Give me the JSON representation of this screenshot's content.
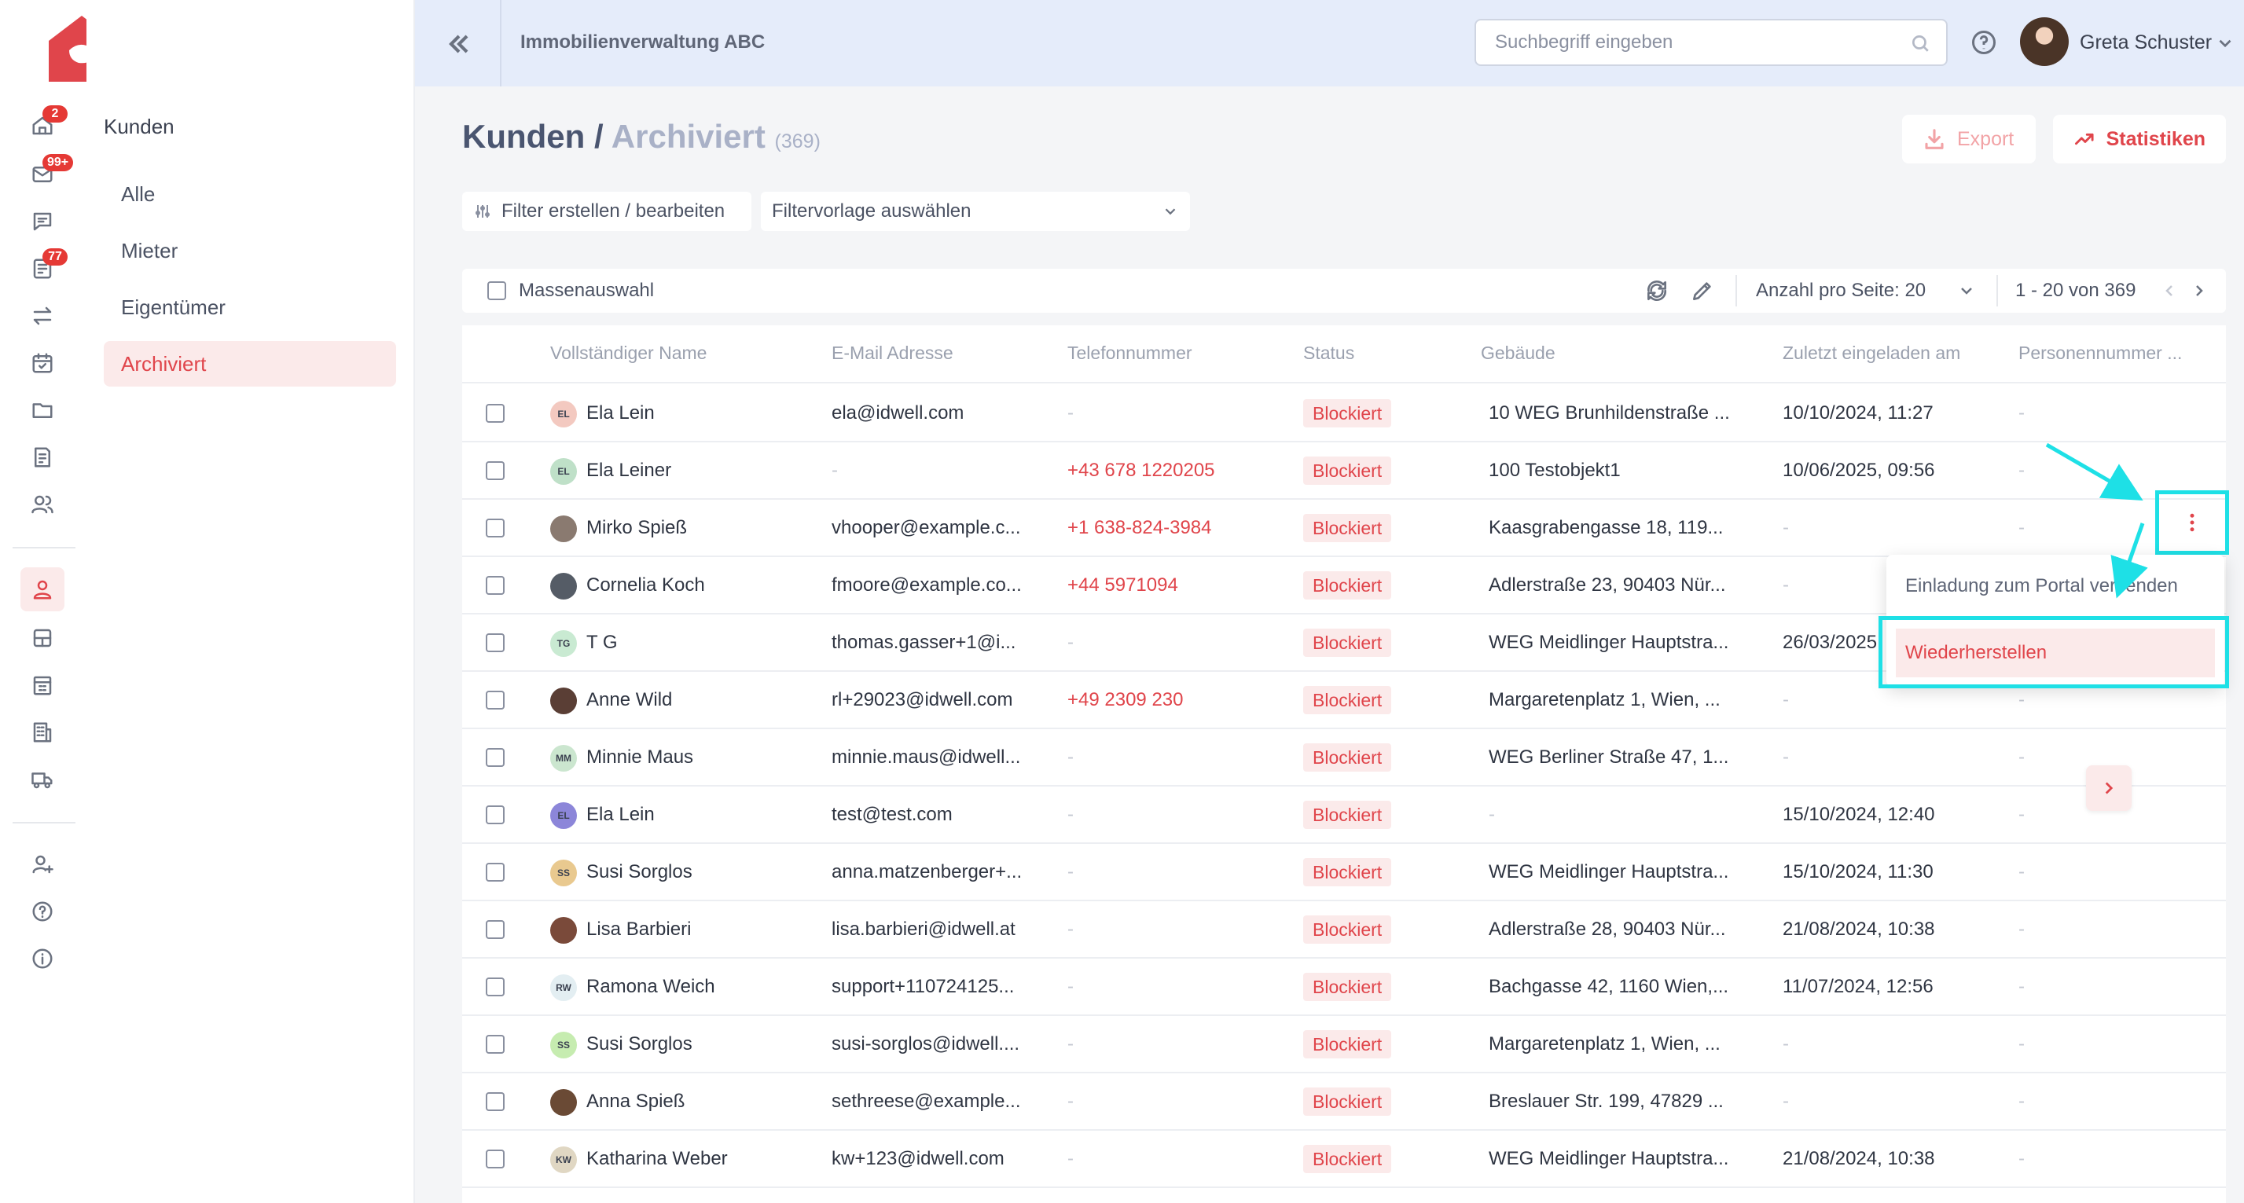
{
  "brand": {
    "name": "idwell"
  },
  "topbar": {
    "org_name": "Immobilienverwaltung ABC",
    "search_placeholder": "Suchbegriff eingeben",
    "user_name": "Greta Schuster"
  },
  "rail": {
    "badges": {
      "home": "2",
      "mail": "99+",
      "tasks": "77"
    }
  },
  "subnav": {
    "title": "Kunden",
    "items": [
      {
        "label": "Alle"
      },
      {
        "label": "Mieter"
      },
      {
        "label": "Eigentümer"
      },
      {
        "label": "Archiviert"
      }
    ]
  },
  "header": {
    "crumb_root": "Kunden",
    "crumb_sep": "/",
    "crumb_active": "Archiviert",
    "count": "(369)",
    "export_label": "Export",
    "stats_label": "Statistiken"
  },
  "filters": {
    "create_label": "Filter erstellen / bearbeiten",
    "template_placeholder": "Filtervorlage auswählen"
  },
  "toolbar": {
    "mass_select_label": "Massenauswahl",
    "per_page_label": "Anzahl pro Seite:",
    "per_page_value": "20",
    "range": "1 - 20 von 369"
  },
  "table": {
    "columns": [
      "Vollständiger Name",
      "E-Mail Adresse",
      "Telefonnummer",
      "Status",
      "Gebäude",
      "Zuletzt eingeladen am",
      "Personennummer ..."
    ],
    "rows": [
      {
        "initials": "EL",
        "avatar_color": "#f3c9c0",
        "name": "Ela Lein",
        "email": "ela@idwell.com",
        "phone": "-",
        "status": "Blockiert",
        "building": "10 WEG Brunhildenstraße ...",
        "invited": "10/10/2024, 11:27",
        "personnr": "-"
      },
      {
        "initials": "EL",
        "avatar_color": "#bfe0c8",
        "name": "Ela Leiner",
        "email": "-",
        "phone": "+43 678 1220205",
        "status": "Blockiert",
        "building": "100 Testobjekt1",
        "invited": "10/06/2025, 09:56",
        "personnr": "-"
      },
      {
        "initials": "",
        "avatar_color": "#8a7a70",
        "name": "Mirko Spieß",
        "email": "vhooper@example.c...",
        "phone": "+1 638-824-3984",
        "status": "Blockiert",
        "building": "Kaasgrabengasse 18, 119...",
        "invited": "-",
        "personnr": "-"
      },
      {
        "initials": "",
        "avatar_color": "#555c66",
        "name": "Cornelia Koch",
        "email": "fmoore@example.co...",
        "phone": "+44 5971094",
        "status": "Blockiert",
        "building": "Adlerstraße 23, 90403 Nür...",
        "invited": "-",
        "personnr": "-"
      },
      {
        "initials": "TG",
        "avatar_color": "#c9ead2",
        "name": "T G",
        "email": "thomas.gasser+1@i...",
        "phone": "-",
        "status": "Blockiert",
        "building": "WEG Meidlinger Hauptstra...",
        "invited": "26/03/2025",
        "personnr": "-"
      },
      {
        "initials": "",
        "avatar_color": "#5a3e35",
        "name": "Anne Wild",
        "email": "rl+29023@idwell.com",
        "phone": "+49 2309 230",
        "status": "Blockiert",
        "building": "Margaretenplatz 1, Wien, ...",
        "invited": "-",
        "personnr": "-"
      },
      {
        "initials": "MM",
        "avatar_color": "#cbe6cf",
        "name": "Minnie Maus",
        "email": "minnie.maus@idwell...",
        "phone": "-",
        "status": "Blockiert",
        "building": "WEG Berliner Straße 47, 1...",
        "invited": "-",
        "personnr": "-"
      },
      {
        "initials": "EL",
        "avatar_color": "#8c86d9",
        "name": "Ela Lein",
        "email": "test@test.com",
        "phone": "-",
        "status": "Blockiert",
        "building": "-",
        "invited": "15/10/2024, 12:40",
        "personnr": "-"
      },
      {
        "initials": "SS",
        "avatar_color": "#e9c98f",
        "name": "Susi Sorglos",
        "email": "anna.matzenberger+...",
        "phone": "-",
        "status": "Blockiert",
        "building": "WEG Meidlinger Hauptstra...",
        "invited": "15/10/2024, 11:30",
        "personnr": "-"
      },
      {
        "initials": "",
        "avatar_color": "#7a4a3a",
        "name": "Lisa Barbieri",
        "email": "lisa.barbieri@idwell.at",
        "phone": "-",
        "status": "Blockiert",
        "building": "Adlerstraße 28, 90403 Nür...",
        "invited": "21/08/2024, 10:38",
        "personnr": "-"
      },
      {
        "initials": "RW",
        "avatar_color": "#e3eef2",
        "name": "Ramona Weich",
        "email": "support+110724125...",
        "phone": "-",
        "status": "Blockiert",
        "building": "Bachgasse 42, 1160 Wien,...",
        "invited": "11/07/2024, 12:56",
        "personnr": "-"
      },
      {
        "initials": "SS",
        "avatar_color": "#c6ecb0",
        "name": "Susi Sorglos",
        "email": "susi-sorglos@idwell....",
        "phone": "-",
        "status": "Blockiert",
        "building": "Margaretenplatz 1, Wien, ...",
        "invited": "-",
        "personnr": "-"
      },
      {
        "initials": "",
        "avatar_color": "#6a4a35",
        "name": "Anna Spieß",
        "email": "sethreese@example...",
        "phone": "-",
        "status": "Blockiert",
        "building": "Breslauer Str. 199, 47829 ...",
        "invited": "-",
        "personnr": "-"
      },
      {
        "initials": "KW",
        "avatar_color": "#e0d7c3",
        "name": "Katharina Weber",
        "email": "kw+123@idwell.com",
        "phone": "-",
        "status": "Blockiert",
        "building": "WEG Meidlinger Hauptstra...",
        "invited": "21/08/2024, 10:38",
        "personnr": "-"
      }
    ]
  },
  "row_menu": {
    "items": [
      {
        "label": "Einladung zum Portal versenden"
      },
      {
        "label": "Wiederherstellen"
      }
    ]
  },
  "colors": {
    "accent": "#e0454b",
    "accent_light": "#fbeaea",
    "annotation": "#1ee0e6",
    "topbar_bg": "#e5ecfa"
  }
}
